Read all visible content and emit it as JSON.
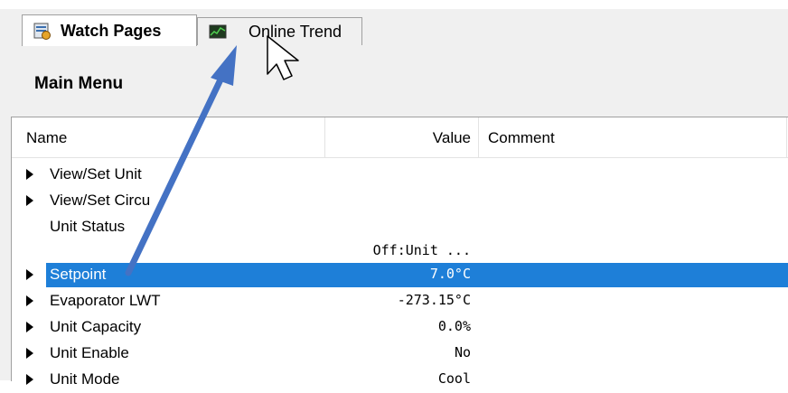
{
  "tabs": [
    {
      "label": "Watch Pages",
      "icon": "watch-pages-icon",
      "active": true
    },
    {
      "label": "Online Trend",
      "icon": "trend-chart-icon",
      "active": false
    }
  ],
  "panel": {
    "title": "Main Menu"
  },
  "grid": {
    "columns": {
      "name": "Name",
      "value": "Value",
      "comment": "Comment"
    },
    "rows": [
      {
        "name": "View/Set Unit",
        "value": "",
        "expander": true
      },
      {
        "name": "View/Set Circu",
        "value": "",
        "expander": true
      },
      {
        "name": "Unit Status",
        "value": "",
        "expander": false
      },
      {
        "name": "",
        "value": "Off:Unit ...",
        "expander": false
      },
      {
        "name": "Setpoint",
        "value": "7.0°C",
        "expander": true,
        "selected": true
      },
      {
        "name": "Evaporator LWT",
        "value": "-273.15°C",
        "expander": true
      },
      {
        "name": "Unit Capacity",
        "value": "0.0%",
        "expander": true
      },
      {
        "name": "Unit Enable",
        "value": "No",
        "expander": true
      },
      {
        "name": "Unit Mode",
        "value": "Cool",
        "expander": true
      }
    ]
  },
  "colors": {
    "selection": "#1e7fd8",
    "arrow": "#4472c4"
  }
}
